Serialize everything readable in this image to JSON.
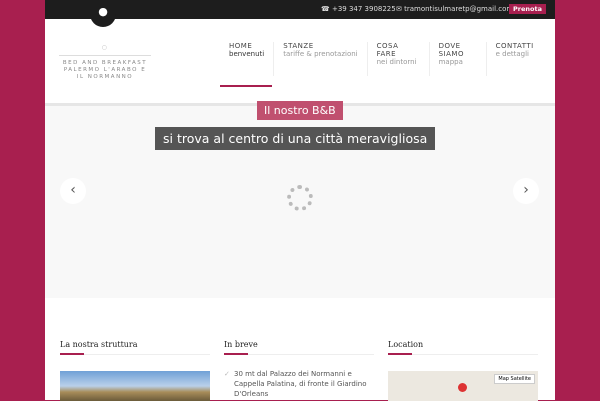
{
  "topbar": {
    "phone": "+39 347 3908225",
    "email": "tramontisulmaretp@gmail.com",
    "book": "Prenota"
  },
  "logo": {
    "line1": "BED AND BREAKFAST",
    "line2": "PALERMO L'ARABO E",
    "line3": "IL NORMANNO"
  },
  "nav": [
    {
      "title": "HOME",
      "sub": "benvenuti"
    },
    {
      "title": "STANZE",
      "sub": "tariffe & prenotazioni"
    },
    {
      "title": "COSA FARE",
      "sub": "nei dintorni"
    },
    {
      "title": "DOVE SIAMO",
      "sub": "mappa"
    },
    {
      "title": "CONTATTI",
      "sub": "e dettagli"
    }
  ],
  "slider": {
    "caption1": "Il nostro B&B",
    "caption2": "si trova al centro di una città meravigliosa"
  },
  "sections": {
    "struttura": "La nostra struttura",
    "breve": "In breve",
    "location": "Location",
    "breve_item": "30 mt dal Palazzo dei Normanni e Cappella Palatina, di fronte il Giardino D'Orleans",
    "map_btn": "Map  Satellite"
  }
}
